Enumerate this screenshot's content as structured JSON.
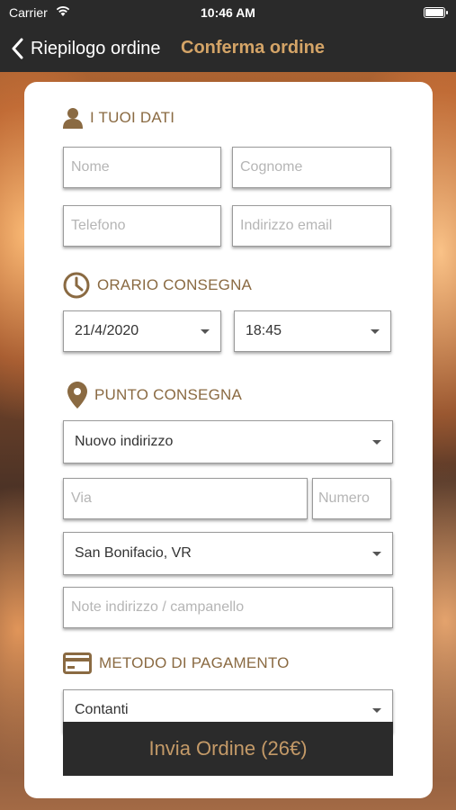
{
  "status_bar": {
    "carrier": "Carrier",
    "time": "10:46 AM"
  },
  "nav": {
    "back_label": "Riepilogo ordine",
    "title": "Conferma ordine"
  },
  "sections": {
    "personal": {
      "title": "I TUOI DATI",
      "nome_placeholder": "Nome",
      "cognome_placeholder": "Cognome",
      "telefono_placeholder": "Telefono",
      "email_placeholder": "Indirizzo email"
    },
    "delivery_time": {
      "title": "ORARIO CONSEGNA",
      "date_value": "21/4/2020",
      "time_value": "18:45"
    },
    "delivery_point": {
      "title": "PUNTO CONSEGNA",
      "address_select": "Nuovo indirizzo",
      "via_placeholder": "Via",
      "numero_placeholder": "Numero",
      "city_select": "San Bonifacio, VR",
      "notes_placeholder": "Note indirizzo / campanello"
    },
    "payment": {
      "title": "METODO DI PAGAMENTO",
      "method_select": "Contanti"
    }
  },
  "submit_label": "Invia Ordine (26€)",
  "colors": {
    "accent": "#8a6a42",
    "nav_title": "#d4a467",
    "bar": "#2a2a2a"
  }
}
